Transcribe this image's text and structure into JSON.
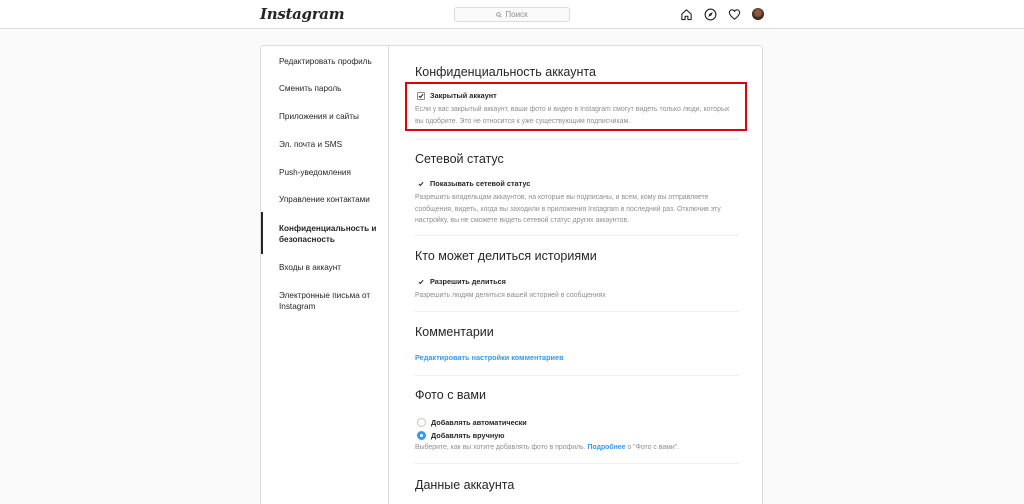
{
  "header": {
    "logo": "Instagram",
    "search_placeholder": "Поиск"
  },
  "sidebar": {
    "items": [
      {
        "label": "Редактировать профиль"
      },
      {
        "label": "Сменить пароль"
      },
      {
        "label": "Приложения и сайты"
      },
      {
        "label": "Эл. почта и SMS"
      },
      {
        "label": "Push-уведомления"
      },
      {
        "label": "Управление контактами"
      },
      {
        "label": "Конфиденциальность и безопасность",
        "active": true
      },
      {
        "label": "Входы в аккаунт"
      },
      {
        "label": "Электронные письма от Instagram"
      }
    ]
  },
  "privacy": {
    "title": "Конфиденциальность аккаунта",
    "checkbox_label": "Закрытый аккаунт",
    "checked": true,
    "description": "Если у вас закрытый аккаунт, ваши фото и видео в Instagram смогут видеть только люди, которых вы одобрите. Это не относится к уже существующим подписчикам."
  },
  "status": {
    "title": "Сетевой статус",
    "checkbox_label": "Показывать сетевой статус",
    "checked": true,
    "description": "Разрешить владельцам аккаунтов, на которые вы подписаны, и всем, кому вы отправляете сообщения, видеть, когда вы заходили в приложения Instagram в последний раз. Отключив эту настройку, вы не сможете видеть сетевой статус других аккаунтов."
  },
  "stories": {
    "title": "Кто может делиться историями",
    "checkbox_label": "Разрешить делиться",
    "checked": true,
    "description": "Разрешить людям делиться вашей историей в сообщениях"
  },
  "comments": {
    "title": "Комментарии",
    "link": "Редактировать настройки комментариев"
  },
  "photos": {
    "title": "Фото с вами",
    "option_auto": "Добавлять автоматически",
    "option_manual": "Добавлять вручную",
    "selected": "manual",
    "description_prefix": "Выберите, как вы хотите добавлять фото в профиль.",
    "learn_more": "Подробнее",
    "description_suffix": "о \"Фото с вами\"."
  },
  "account_data": {
    "title": "Данные аккаунта"
  },
  "colors": {
    "accent": "#3897f0",
    "highlight": "#e2000d",
    "border": "#dbdbdb",
    "muted": "#8e8e8e"
  }
}
